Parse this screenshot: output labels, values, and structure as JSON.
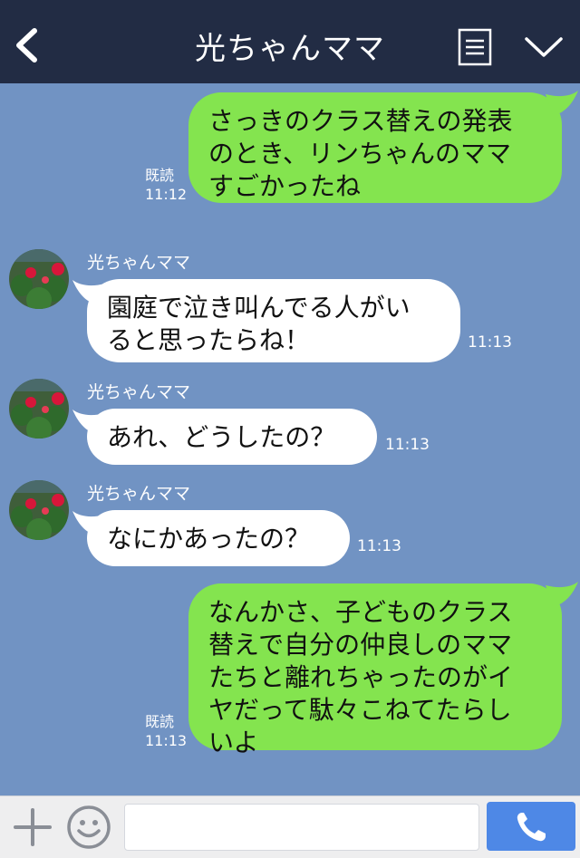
{
  "header": {
    "title": "光ちゃんママ",
    "icons": [
      "back-icon",
      "menu-icon",
      "chevron-down-icon"
    ]
  },
  "messages": [
    {
      "side": "me",
      "lines": "さっきのクラス替えの発表\nのとき、リンちゃんのママ\nすごかったね",
      "read_label": "既読",
      "time": "11:12"
    },
    {
      "side": "them",
      "sender": "光ちゃんママ",
      "lines": "園庭で泣き叫んでる人がい\nると思ったらね！",
      "time": "11:13"
    },
    {
      "side": "them",
      "sender": "光ちゃんママ",
      "lines": "あれ、どうしたの？",
      "time": "11:13"
    },
    {
      "side": "them",
      "sender": "光ちゃんママ",
      "lines": "なにかあったの？",
      "time": "11:13"
    },
    {
      "side": "me",
      "lines": "なんかさ、子どものクラス\n替えで自分の仲良しのママ\nたちと離れちゃったのがイ\nヤだって駄々こねてたらし\nいよ",
      "read_label": "既読",
      "time": "11:13"
    }
  ],
  "input": {
    "placeholder": "",
    "value": ""
  },
  "colors": {
    "header_bg": "#222c44",
    "chat_bg": "#7193c3",
    "my_bubble": "#84e44f",
    "their_bubble": "#ffffff",
    "send_button": "#4e88e6"
  }
}
